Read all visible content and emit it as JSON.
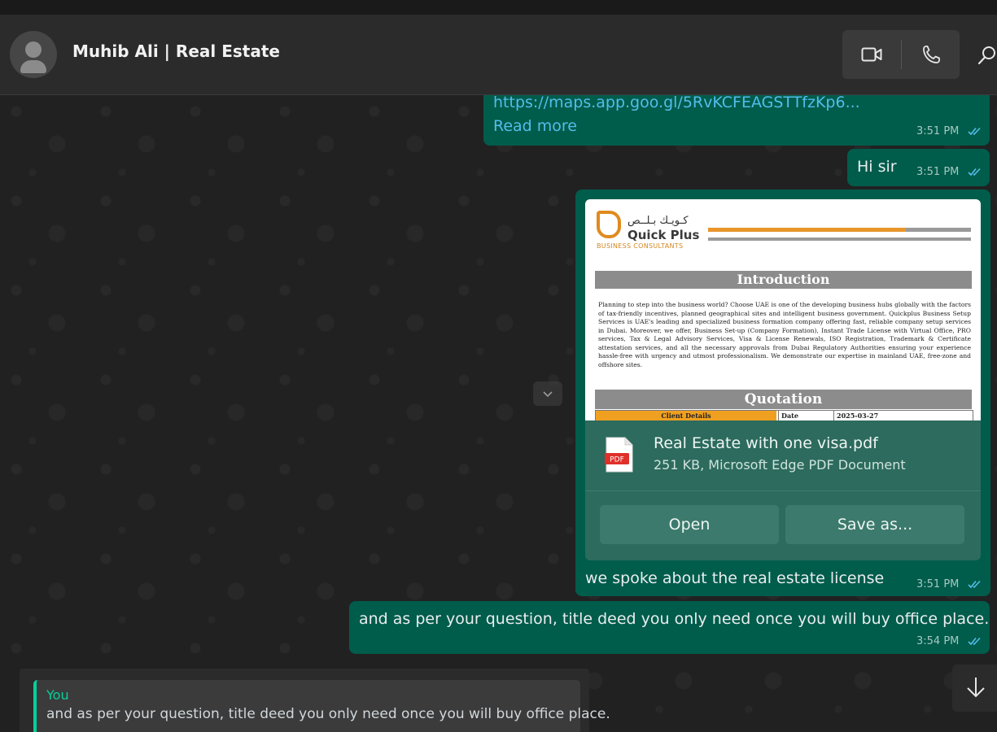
{
  "header": {
    "contact_name": "Muhib Ali | Real Estate",
    "icons": [
      "avatar-icon",
      "video-call-icon",
      "voice-call-icon",
      "search-icon"
    ]
  },
  "messages": {
    "m1": {
      "link": "https://maps.app.goo.gl/5RvKCFEAGSTTfzKp6...",
      "read_more": "Read more",
      "time": "3:51 PM"
    },
    "m2": {
      "text": "Hi sir",
      "time": "3:51 PM"
    },
    "m3": {
      "preview": {
        "logo_ar": "كـويـك بـلــص",
        "logo_en": "Quick Plus",
        "logo_sub": "BUSINESS CONSULTANTS",
        "intro_title": "Introduction",
        "intro_text": "Planning to step into the business world? Choose UAE is one of the developing business hubs globally with the factors of tax-friendly incentives, planned geographical sites and intelligent business government. Quickplus Business Setup Services is UAE's leading and specialized business formation company offering fast, reliable company setup services in Dubai. Moreover, we offer, Business Set-up (Company Formation), Instant Trade License with Virtual Office, PRO services, Tax & Legal Advisory Services, Visa & License Renewals, ISO Registration, Trademark & Certificate attestation services, and all the necessary approvals from Dubai Regulatory Authorities ensuring your experience hassle-free with urgency and utmost professionalism. We demonstrate our expertise in mainland UAE, free-zone and offshore sites.",
        "quotation_title": "Quotation",
        "client_details": "Client Details",
        "date_label": "Date",
        "date_value": "2025-03-27"
      },
      "file_icon_label": "PDF",
      "file_name": "Real Estate with one visa.pdf",
      "file_meta": "251 KB, Microsoft Edge PDF Document",
      "open_label": "Open",
      "save_label": "Save as...",
      "caption": "we spoke about the real estate license",
      "time": "3:51 PM"
    },
    "m4": {
      "text": "and as per your question, title deed you only need once you will buy office place.",
      "time": "3:54 PM"
    }
  },
  "composer": {
    "reply_author": "You",
    "reply_text": "and as per your question, title deed you only need once you will buy office place."
  },
  "colors": {
    "outgoing_bubble": "#005c4b",
    "read_ticks": "#53bdeb",
    "accent": "#06cf9c",
    "header": "#2b2b2b"
  }
}
